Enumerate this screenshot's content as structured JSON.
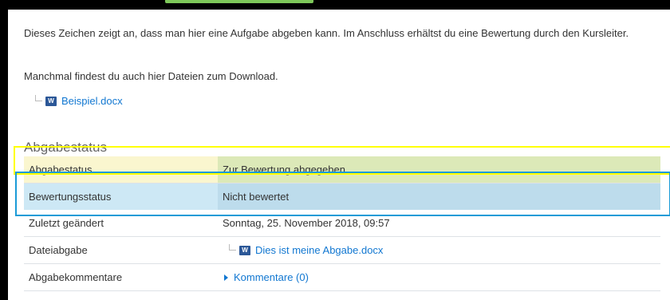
{
  "intro": {
    "paragraph1": "Dieses Zeichen zeigt an, dass man hier eine Aufgabe abgeben kann. Im Anschluss erhältst du eine Bewertung durch den Kursleiter.",
    "paragraph2": "Manchmal findest du auch hier Dateien zum Download."
  },
  "download": {
    "filename": "Beispiel.docx",
    "icon": "word-document-icon"
  },
  "section": {
    "title": "Abgabestatus"
  },
  "status_table": {
    "rows": [
      {
        "label": "Abgabestatus",
        "value": "Zur Bewertung abgegeben"
      },
      {
        "label": "Bewertungsstatus",
        "value": "Nicht bewertet"
      },
      {
        "label": "Zuletzt geändert",
        "value": "Sonntag, 25. November 2018, 09:57"
      },
      {
        "label": "Dateiabgabe",
        "value": "Dies ist meine Abgabe.docx"
      },
      {
        "label": "Abgabekommentare",
        "value": "Kommentare (0)"
      }
    ]
  },
  "colors": {
    "link": "#1177d1",
    "highlight_yellow": "#ffff00",
    "highlight_blue": "#1a9bd7",
    "submitted_row": "#dce9b8",
    "grading_row": "#cde8f5"
  }
}
